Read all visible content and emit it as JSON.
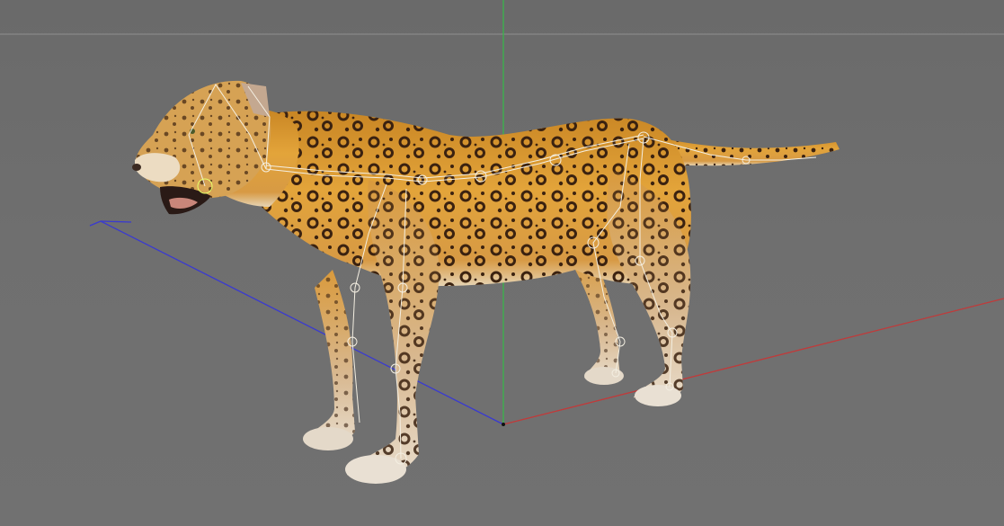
{
  "viewport": {
    "background": "#6e6e6e",
    "horizon_line_color": "#8f8f8f"
  },
  "axes": {
    "x_color": "#c13a3a",
    "y_color": "#39b54a",
    "z_color": "#3a3ad0"
  },
  "model": {
    "fur_base": "#d9962e",
    "fur_light": "#f1c56a",
    "fur_belly": "#e9dcc6",
    "spot_color": "#3b2210",
    "rig_color": "#f4efe2"
  }
}
